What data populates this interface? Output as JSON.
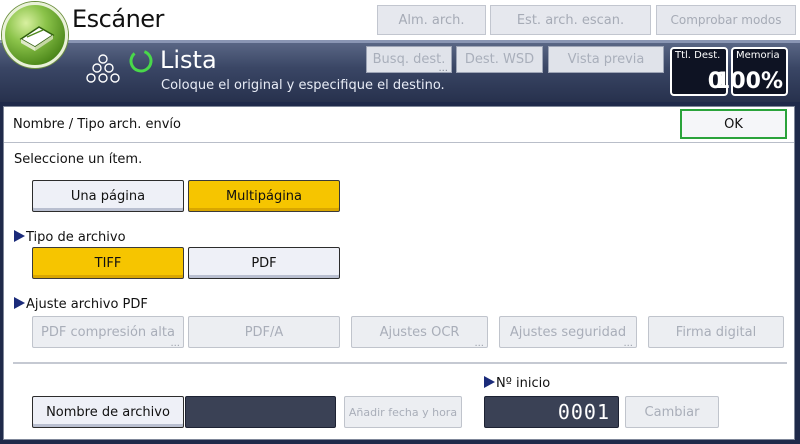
{
  "header": {
    "app_title": "Escáner",
    "buttons": {
      "stored_files": "Alm. arch.",
      "scan_file_status": "Est. arch. escan.",
      "check_modes": "Comprobar modos"
    }
  },
  "status": {
    "title": "Lista",
    "message": "Coloque el original y especifique el destino.",
    "buttons": {
      "search_dest": "Busq. dest.",
      "wsd_dest": "Dest. WSD",
      "preview": "Vista previa"
    },
    "total_dest": {
      "label": "Ttl. Dest.",
      "value": "0"
    },
    "memory": {
      "label": "Memoria",
      "value": "100%"
    }
  },
  "panel": {
    "title": "Nombre / Tipo arch. envío",
    "ok_label": "OK",
    "select_prompt": "Seleccione un ítem.",
    "page_options": {
      "single": "Una página",
      "multi": "Multipágina",
      "selected": "multi"
    },
    "file_type": {
      "label": "Tipo de archivo",
      "tiff": "TIFF",
      "pdf": "PDF",
      "selected": "tiff"
    },
    "pdf_settings": {
      "label": "Ajuste archivo PDF",
      "buttons": {
        "high_compression": "PDF compresión alta",
        "pdfa": "PDF/A",
        "ocr": "Ajustes OCR",
        "security": "Ajustes seguridad",
        "digital_signature": "Firma digital"
      }
    },
    "file_name_button": "Nombre de archivo",
    "file_name_value": "",
    "add_date_time": "Añadir fecha y hora",
    "start_number": {
      "label": "Nº inicio",
      "value": "0001",
      "change_label": "Cambiar"
    }
  }
}
